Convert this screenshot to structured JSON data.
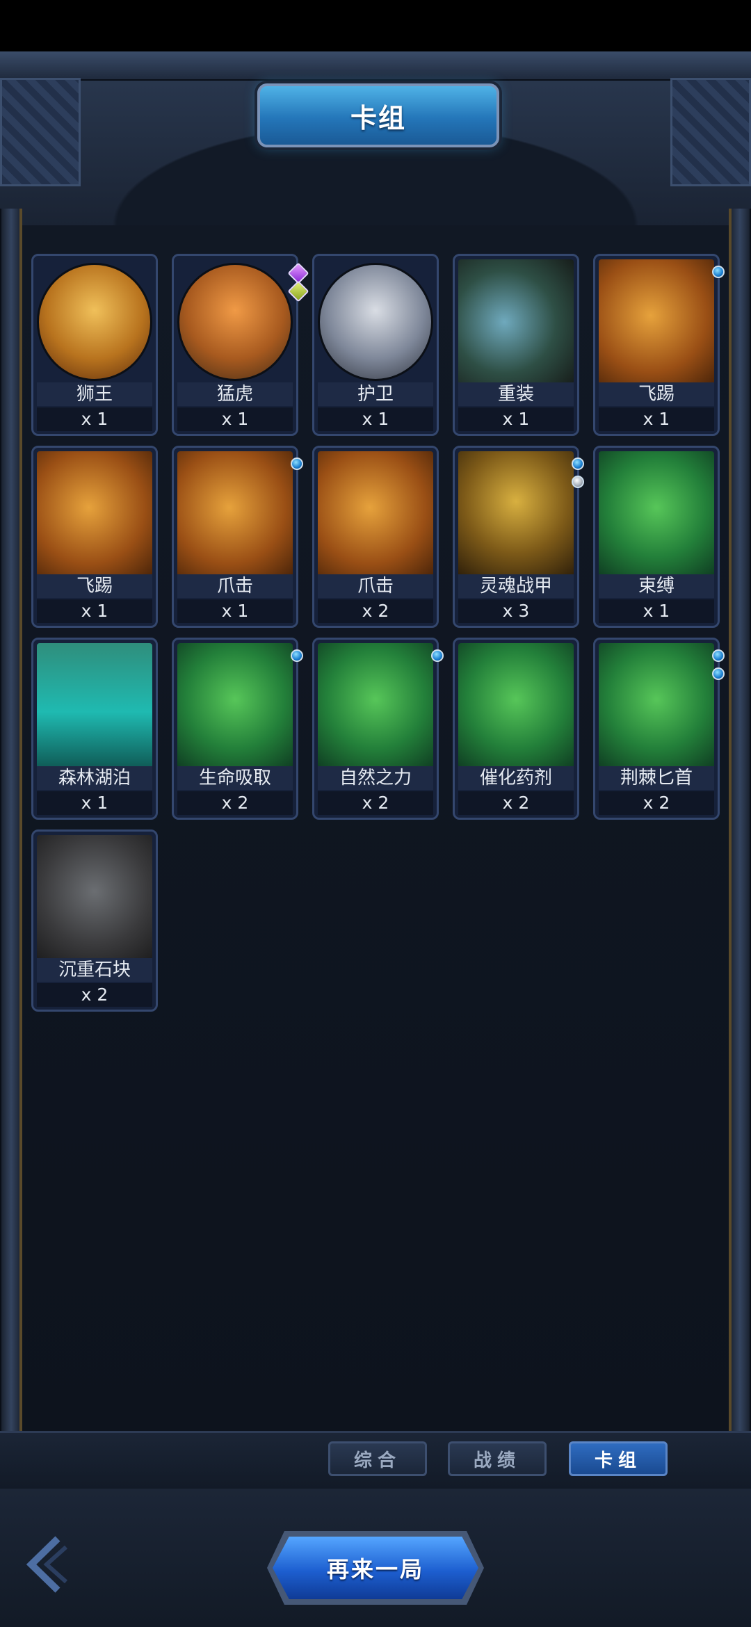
{
  "header": {
    "title": "卡组"
  },
  "cards": [
    {
      "name": "狮王",
      "count": "x 1",
      "art": "lion-king-portrait",
      "style": "portrait disc-lion",
      "gems": []
    },
    {
      "name": "猛虎",
      "count": "x 1",
      "art": "tiger-portrait",
      "style": "portrait disc-tiger",
      "gems": [
        "diamond purple",
        "diamond olive"
      ]
    },
    {
      "name": "护卫",
      "count": "x 1",
      "art": "guard-portrait",
      "style": "portrait disc-guard",
      "gems": []
    },
    {
      "name": "重装",
      "count": "x 1",
      "art": "heavy-armor-art",
      "style": "art-heavy",
      "gems": []
    },
    {
      "name": "飞踢",
      "count": "x 1",
      "art": "flying-kick-art",
      "style": "art-orange",
      "gems": [
        "blue"
      ]
    },
    {
      "name": "飞踢",
      "count": "x 1",
      "art": "flying-kick-art",
      "style": "art-orange",
      "gems": []
    },
    {
      "name": "爪击",
      "count": "x 1",
      "art": "claw-strike-art",
      "style": "art-orange",
      "gems": [
        "blue"
      ]
    },
    {
      "name": "爪击",
      "count": "x 2",
      "art": "claw-strike-art",
      "style": "art-orange",
      "gems": []
    },
    {
      "name": "灵魂战甲",
      "count": "x 3",
      "art": "soul-armor-art",
      "style": "art-armor",
      "gems": [
        "blue",
        "silver"
      ]
    },
    {
      "name": "束缚",
      "count": "x 1",
      "art": "bind-art",
      "style": "art-green",
      "gems": []
    },
    {
      "name": "森林湖泊",
      "count": "x 1",
      "art": "forest-lake-art",
      "style": "art-lake",
      "gems": []
    },
    {
      "name": "生命吸取",
      "count": "x 2",
      "art": "life-drain-art",
      "style": "art-green",
      "gems": [
        "blue"
      ]
    },
    {
      "name": "自然之力",
      "count": "x 2",
      "art": "force-of-nature-art",
      "style": "art-green",
      "gems": [
        "blue"
      ]
    },
    {
      "name": "催化药剂",
      "count": "x 2",
      "art": "catalyst-potion-art",
      "style": "art-green",
      "gems": []
    },
    {
      "name": "荆棘匕首",
      "count": "x 2",
      "art": "thorn-dagger-art",
      "style": "art-green",
      "gems": [
        "blue",
        "blue"
      ]
    },
    {
      "name": "沉重石块",
      "count": "x 2",
      "art": "heavy-stone-art",
      "style": "art-stone",
      "gems": []
    }
  ],
  "tabs": [
    {
      "label": "综合",
      "active": false
    },
    {
      "label": "战绩",
      "active": false
    },
    {
      "label": "卡组",
      "active": true
    }
  ],
  "footer": {
    "play_again": "再来一局"
  }
}
